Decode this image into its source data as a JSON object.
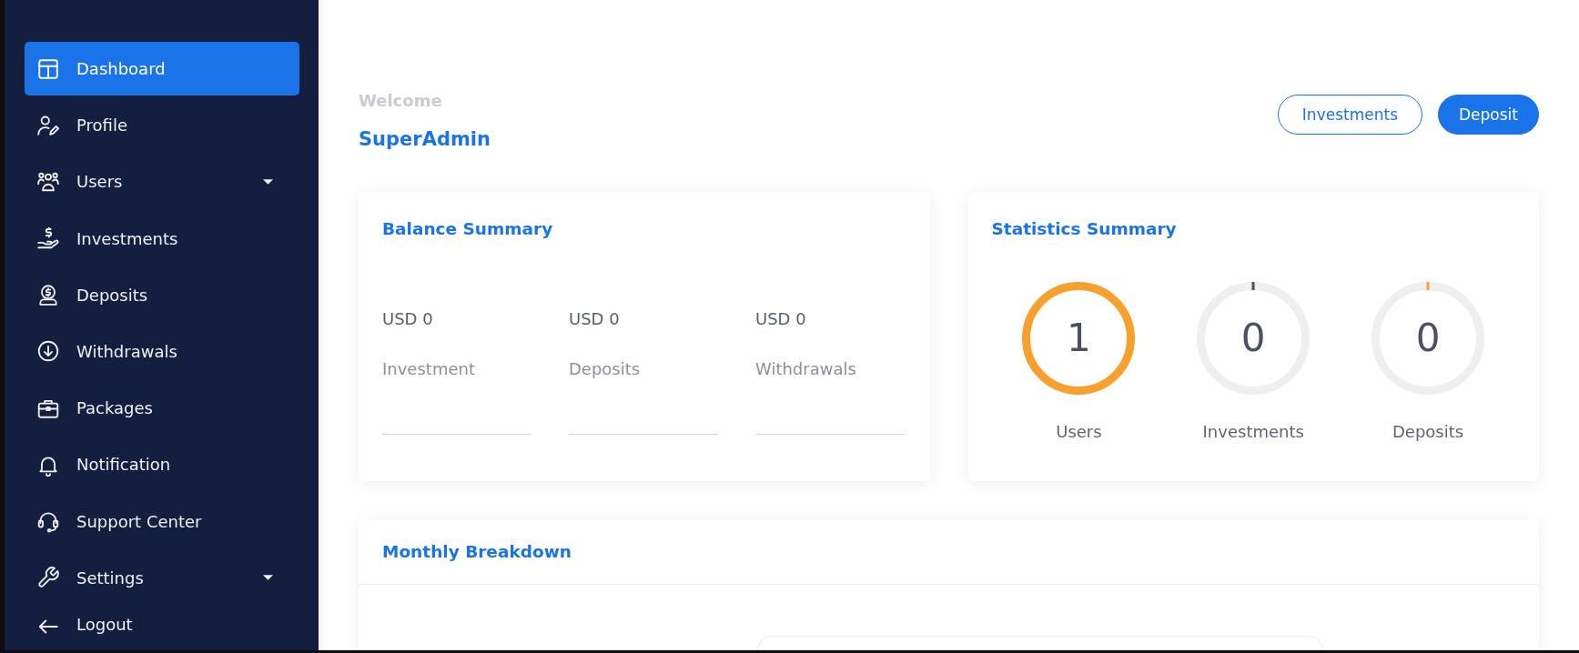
{
  "sidebar": {
    "items": [
      {
        "label": "Dashboard",
        "selected": true,
        "has_submenu": false
      },
      {
        "label": "Profile",
        "selected": false,
        "has_submenu": false
      },
      {
        "label": "Users",
        "selected": false,
        "has_submenu": true
      },
      {
        "label": "Investments",
        "selected": false,
        "has_submenu": false
      },
      {
        "label": "Deposits",
        "selected": false,
        "has_submenu": false
      },
      {
        "label": "Withdrawals",
        "selected": false,
        "has_submenu": false
      },
      {
        "label": "Packages",
        "selected": false,
        "has_submenu": false
      },
      {
        "label": "Notification",
        "selected": false,
        "has_submenu": false
      },
      {
        "label": "Support Center",
        "selected": false,
        "has_submenu": false
      },
      {
        "label": "Settings",
        "selected": false,
        "has_submenu": true
      },
      {
        "label": "Logout",
        "selected": false,
        "has_submenu": false
      }
    ]
  },
  "header": {
    "greeting": "Welcome",
    "user_name": "SuperAdmin",
    "buttons": [
      {
        "label": "Investments",
        "kind": "outline"
      },
      {
        "label": "Deposit",
        "kind": "filled"
      }
    ]
  },
  "balance_summary": {
    "title": "Balance Summary",
    "items": [
      {
        "amount": "USD 0",
        "label": "Investment"
      },
      {
        "amount": "USD 0",
        "label": "Deposits"
      },
      {
        "amount": "USD 0",
        "label": "Withdrawals"
      }
    ]
  },
  "statistics_summary": {
    "title": "Statistics Summary",
    "items": [
      {
        "value": "1",
        "label": "Users",
        "complete": true,
        "color": "#f7a02d"
      },
      {
        "value": "0",
        "label": "Investments",
        "complete": false,
        "color": "#4b5163"
      },
      {
        "value": "0",
        "label": "Deposits",
        "complete": false,
        "color": "#f7a02d"
      }
    ]
  },
  "monthly_breakdown": {
    "title": "Monthly Breakdown"
  }
}
